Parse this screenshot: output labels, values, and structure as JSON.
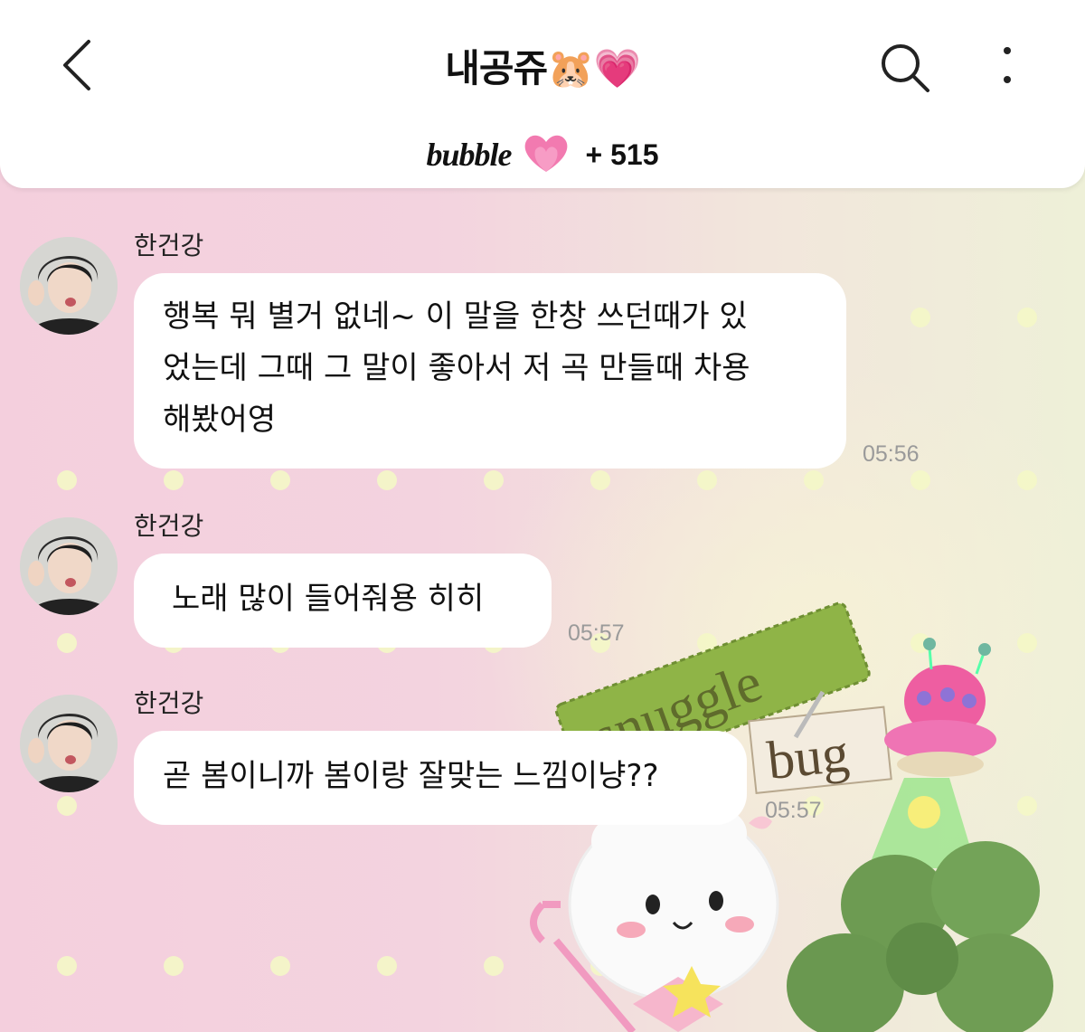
{
  "header": {
    "title": "내공쥬🐹💗",
    "service_logo": "bubble",
    "heart_icon": "pink-heart-icon",
    "count": "+ 515",
    "icons": [
      "back-chevron-icon",
      "search-icon",
      "more-vertical-icon"
    ]
  },
  "messages": [
    {
      "sender": "한건강",
      "lines": [
        "행복 뭐 별거 없네~ 이 말을 한창 쓰던때가 있",
        "었는데 그때 그 말이 좋아서 저 곡 만들때 차용",
        "해봤어영"
      ],
      "time": "05:56"
    },
    {
      "sender": "한건강",
      "lines": [
        "노래 많이 들어줘용 히히"
      ],
      "time": "05:57"
    },
    {
      "sender": "한건강",
      "lines": [
        "곧 봄이니까 봄이랑 잘맞는 느낌이냥??"
      ],
      "time": "05:57"
    }
  ],
  "wallpaper": {
    "patch_text_1": "snuggle",
    "patch_text_2": "bug"
  },
  "colors": {
    "background_pink": "#f3d6e1",
    "bubble_white": "#ffffff",
    "dot_yellow": "#f4f7c6",
    "heart_pink": "#f27ab0"
  }
}
